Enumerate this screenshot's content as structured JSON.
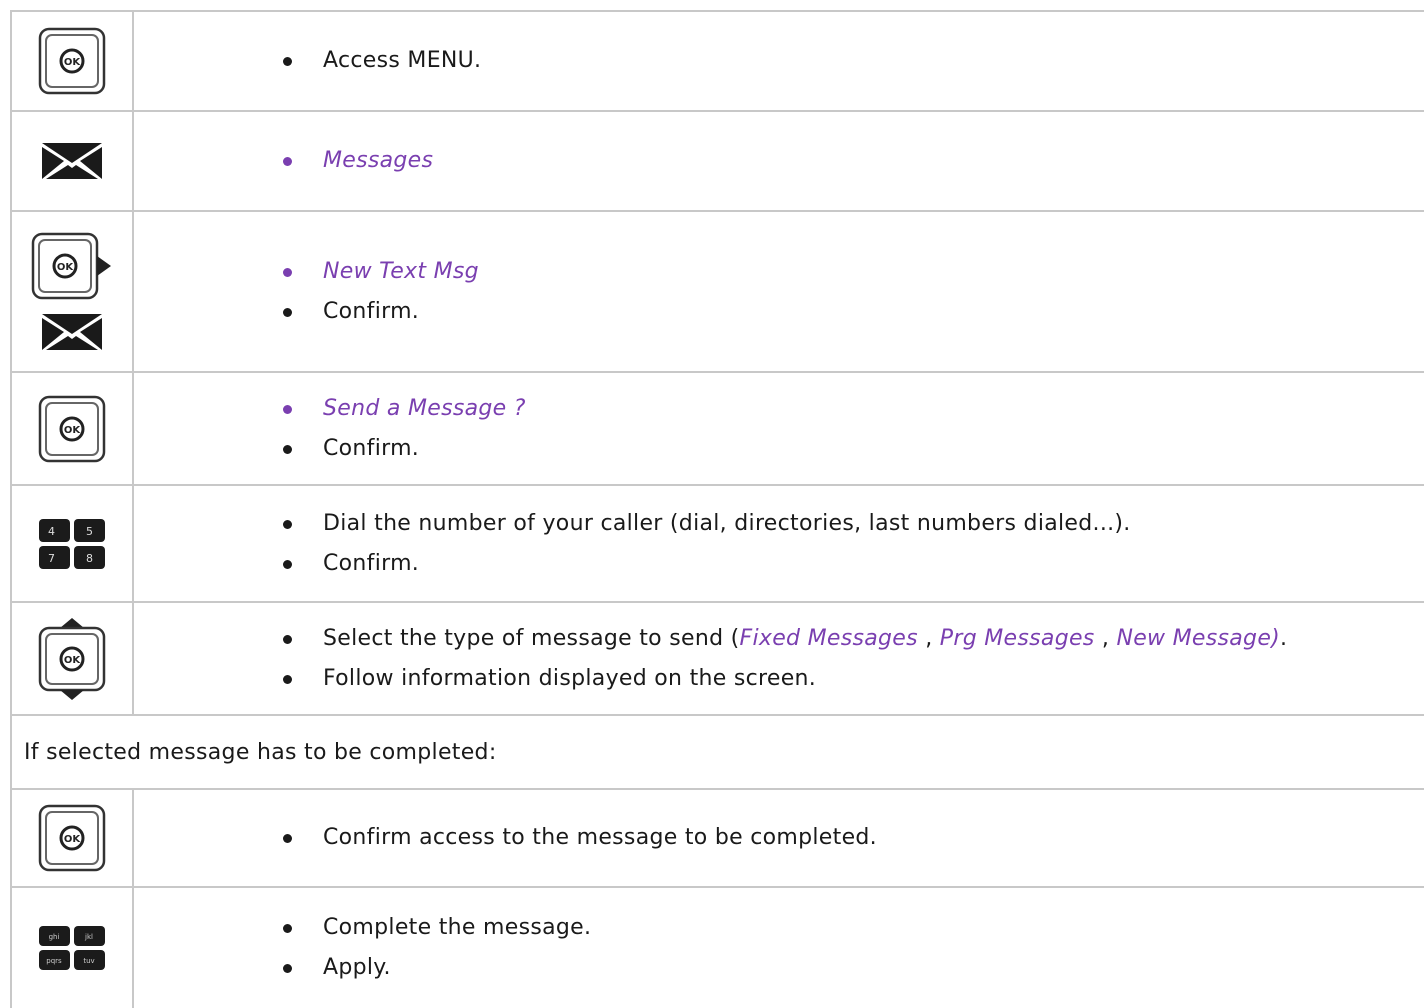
{
  "colors": {
    "accent_purple": "#7a3fb0",
    "border": "#c8c8c8",
    "text": "#1a1a1a"
  },
  "rows": [
    {
      "icons": [
        "ok-key-icon"
      ],
      "items": [
        {
          "text": "Access MENU.",
          "style": "normal"
        }
      ]
    },
    {
      "icons": [
        "envelope-icon"
      ],
      "items": [
        {
          "text": "Messages",
          "style": "italic-purple"
        }
      ]
    },
    {
      "icons": [
        "ok-right-arrow-key-icon",
        "envelope-icon"
      ],
      "items": [
        {
          "text": "New Text Msg",
          "style": "italic-purple"
        },
        {
          "text": "Confirm.",
          "style": "normal"
        }
      ]
    },
    {
      "icons": [
        "ok-key-icon"
      ],
      "items": [
        {
          "text": "Send a Message ?",
          "style": "italic-purple"
        },
        {
          "text": "Confirm.",
          "style": "normal"
        }
      ]
    },
    {
      "icons": [
        "numeric-keypad-icon"
      ],
      "items": [
        {
          "text": "Dial the number of your caller (dial, directories, last numbers dialed...).",
          "style": "normal"
        },
        {
          "text": "Confirm.",
          "style": "normal"
        }
      ]
    },
    {
      "icons": [
        "ok-up-down-navigator-icon"
      ],
      "select_line": {
        "prefix": "Select the type of message to send (",
        "option1": "Fixed Messages",
        "sep1": " , ",
        "option2": "Prg Messages",
        "sep2": " , ",
        "option3": "New Message)",
        "suffix": "."
      },
      "items": [
        {
          "text": "Follow information displayed on the screen.",
          "style": "normal"
        }
      ]
    }
  ],
  "section_note": "If selected message has to be completed:",
  "rows2": [
    {
      "icons": [
        "ok-key-icon"
      ],
      "items": [
        {
          "text": "Confirm access to the message to be completed.",
          "style": "normal"
        }
      ]
    },
    {
      "icons": [
        "alpha-keypad-icon"
      ],
      "items": [
        {
          "text": "Complete the message.",
          "style": "normal"
        },
        {
          "text": "Apply.",
          "style": "normal"
        }
      ]
    }
  ],
  "keypad": {
    "numeric": [
      "4",
      "5",
      "7",
      "8"
    ],
    "alpha": [
      "ghi",
      "jkl",
      "pqrs",
      "tuv"
    ]
  }
}
